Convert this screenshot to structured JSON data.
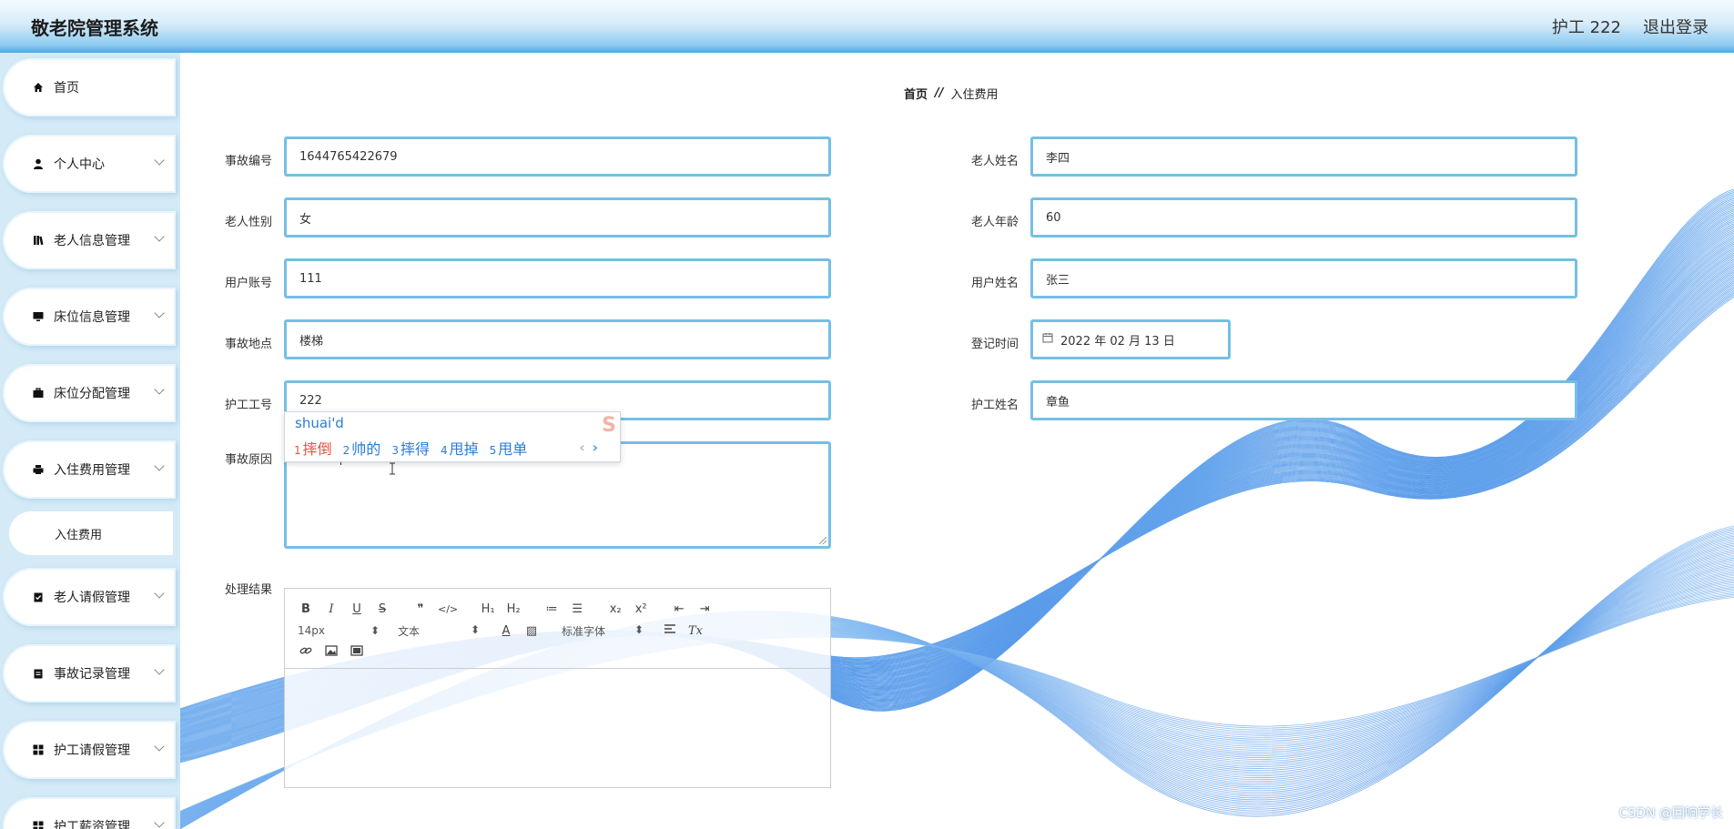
{
  "header": {
    "app_title": "敬老院管理系统",
    "user": "护工 222",
    "logout": "退出登录"
  },
  "sidebar": {
    "items": [
      {
        "label": "首页",
        "icon": "home-icon"
      },
      {
        "label": "个人中心",
        "icon": "user-icon"
      },
      {
        "label": "老人信息管理",
        "icon": "book-icon"
      },
      {
        "label": "床位信息管理",
        "icon": "monitor-icon"
      },
      {
        "label": "床位分配管理",
        "icon": "briefcase-icon"
      },
      {
        "label": "入住费用管理",
        "icon": "printer-icon"
      },
      {
        "label": "老人请假管理",
        "icon": "clipboard-check-icon"
      },
      {
        "label": "事故记录管理",
        "icon": "clipboard-icon"
      },
      {
        "label": "护工请假管理",
        "icon": "grid-icon"
      },
      {
        "label": "护工薪资管理",
        "icon": "grid-icon"
      }
    ],
    "sub_item": "入住费用"
  },
  "breadcrumb": {
    "home": "首页",
    "sep": "//",
    "current": "入住费用"
  },
  "form": {
    "accident_no": {
      "label": "事故编号",
      "value": "1644765422679"
    },
    "elder_name": {
      "label": "老人姓名",
      "value": "李四"
    },
    "elder_gender": {
      "label": "老人性别",
      "value": "女"
    },
    "elder_age": {
      "label": "老人年龄",
      "value": "60"
    },
    "user_account": {
      "label": "用户账号",
      "value": "111"
    },
    "user_name": {
      "label": "用户姓名",
      "value": "张三"
    },
    "accident_place": {
      "label": "事故地点",
      "value": "楼梯"
    },
    "register_time": {
      "label": "登记时间",
      "value": "2022 年 02 月 13 日"
    },
    "nurse_no": {
      "label": "护工工号",
      "value": "222"
    },
    "nurse_name": {
      "label": "护工姓名",
      "value": "章鱼"
    },
    "accident_reason": {
      "label": "事故原因",
      "value": "shuaid"
    },
    "result": {
      "label": "处理结果"
    }
  },
  "ime": {
    "pinyin": "shuai'd",
    "candidates": [
      {
        "num": "1",
        "text": "摔倒"
      },
      {
        "num": "2",
        "text": "帅的"
      },
      {
        "num": "3",
        "text": "摔得"
      },
      {
        "num": "4",
        "text": "甩掉"
      },
      {
        "num": "5",
        "text": "甩单"
      }
    ],
    "prev": "‹",
    "next": "›",
    "logo": "S"
  },
  "editor": {
    "font_size": "14px",
    "block_format": "文本",
    "font_family": "标准字体",
    "buttons_row1": [
      "B",
      "I",
      "U",
      "S",
      "❞",
      "</>",
      "H₁",
      "H₂",
      "≔",
      "☰",
      "x₂",
      "x²",
      "⇤",
      "⇥"
    ],
    "color_buttons": [
      "A",
      "▨"
    ],
    "clear_format": "Tx"
  },
  "watermark": "CSDN @回响学长"
}
